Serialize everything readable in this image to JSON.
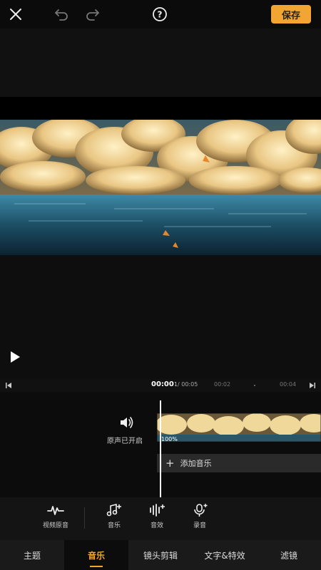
{
  "header": {
    "save_label": "保存",
    "icons": [
      "close-icon",
      "undo-icon",
      "redo-icon",
      "help-icon"
    ]
  },
  "player": {
    "play_icon": "play-icon"
  },
  "timeline": {
    "current_time": "00:00",
    "current_sub": "1",
    "total_time": "/ 00:05",
    "tick_2": "00:02",
    "tick_4": "00:04"
  },
  "tracks": {
    "original_audio_label": "原声已开启",
    "clip_percent": "100%",
    "add_music_label": "添加音乐"
  },
  "tools": [
    {
      "label": "视频原音",
      "icon": "waveform-icon"
    },
    {
      "label": "音乐",
      "icon": "music-add-icon"
    },
    {
      "label": "音效",
      "icon": "sound-effect-icon"
    },
    {
      "label": "录音",
      "icon": "microphone-icon"
    }
  ],
  "tabs": [
    {
      "label": "主题"
    },
    {
      "label": "音乐",
      "active": true
    },
    {
      "label": "镜头剪辑"
    },
    {
      "label": "文字&特效"
    },
    {
      "label": "滤镜"
    }
  ],
  "colors": {
    "accent": "#f2a531",
    "background": "#0a0a0a"
  }
}
